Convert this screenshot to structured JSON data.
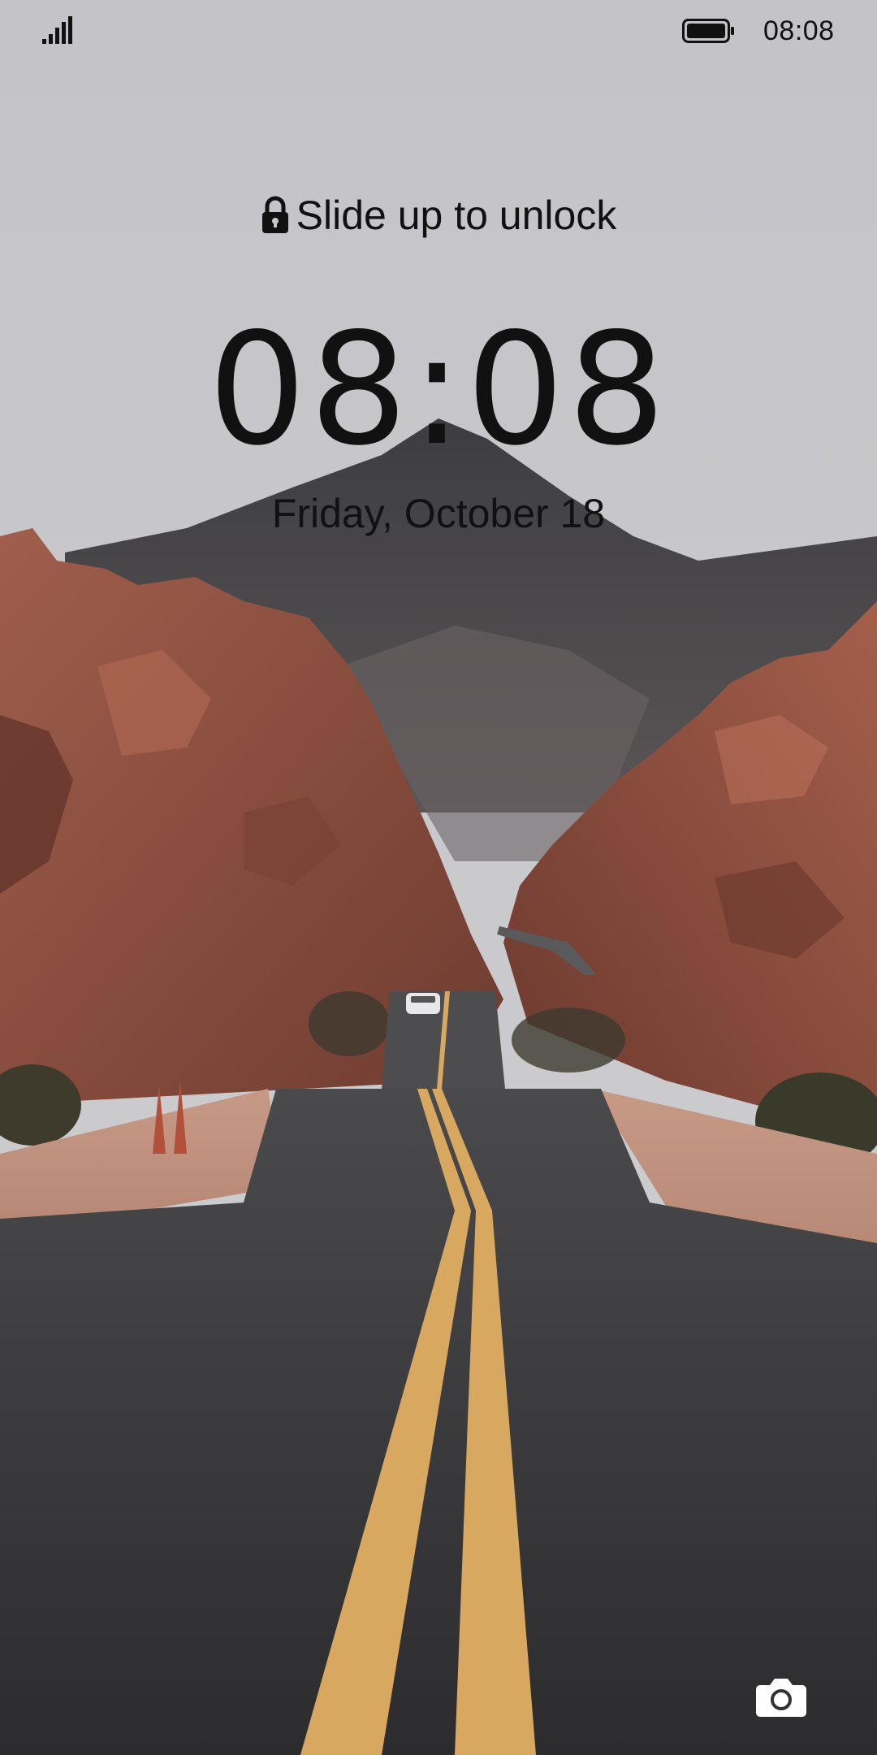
{
  "status_bar": {
    "signal_icon": "signal-strength-icon",
    "battery_icon": "battery-full-icon",
    "time": "08:08"
  },
  "lock_screen": {
    "unlock_hint": "Slide up to unlock",
    "lock_icon": "lock-icon",
    "clock": "08:08",
    "date": "Friday, October 18",
    "camera_icon": "camera-icon"
  },
  "wallpaper": {
    "description_icon": "desert-road-wallpaper",
    "colors": {
      "sky": "#c6c6ca",
      "rock": "#9a5a4a",
      "mountain": "#4b4b4d",
      "road": "#3a3a3c",
      "road_line": "#d8a860"
    }
  }
}
